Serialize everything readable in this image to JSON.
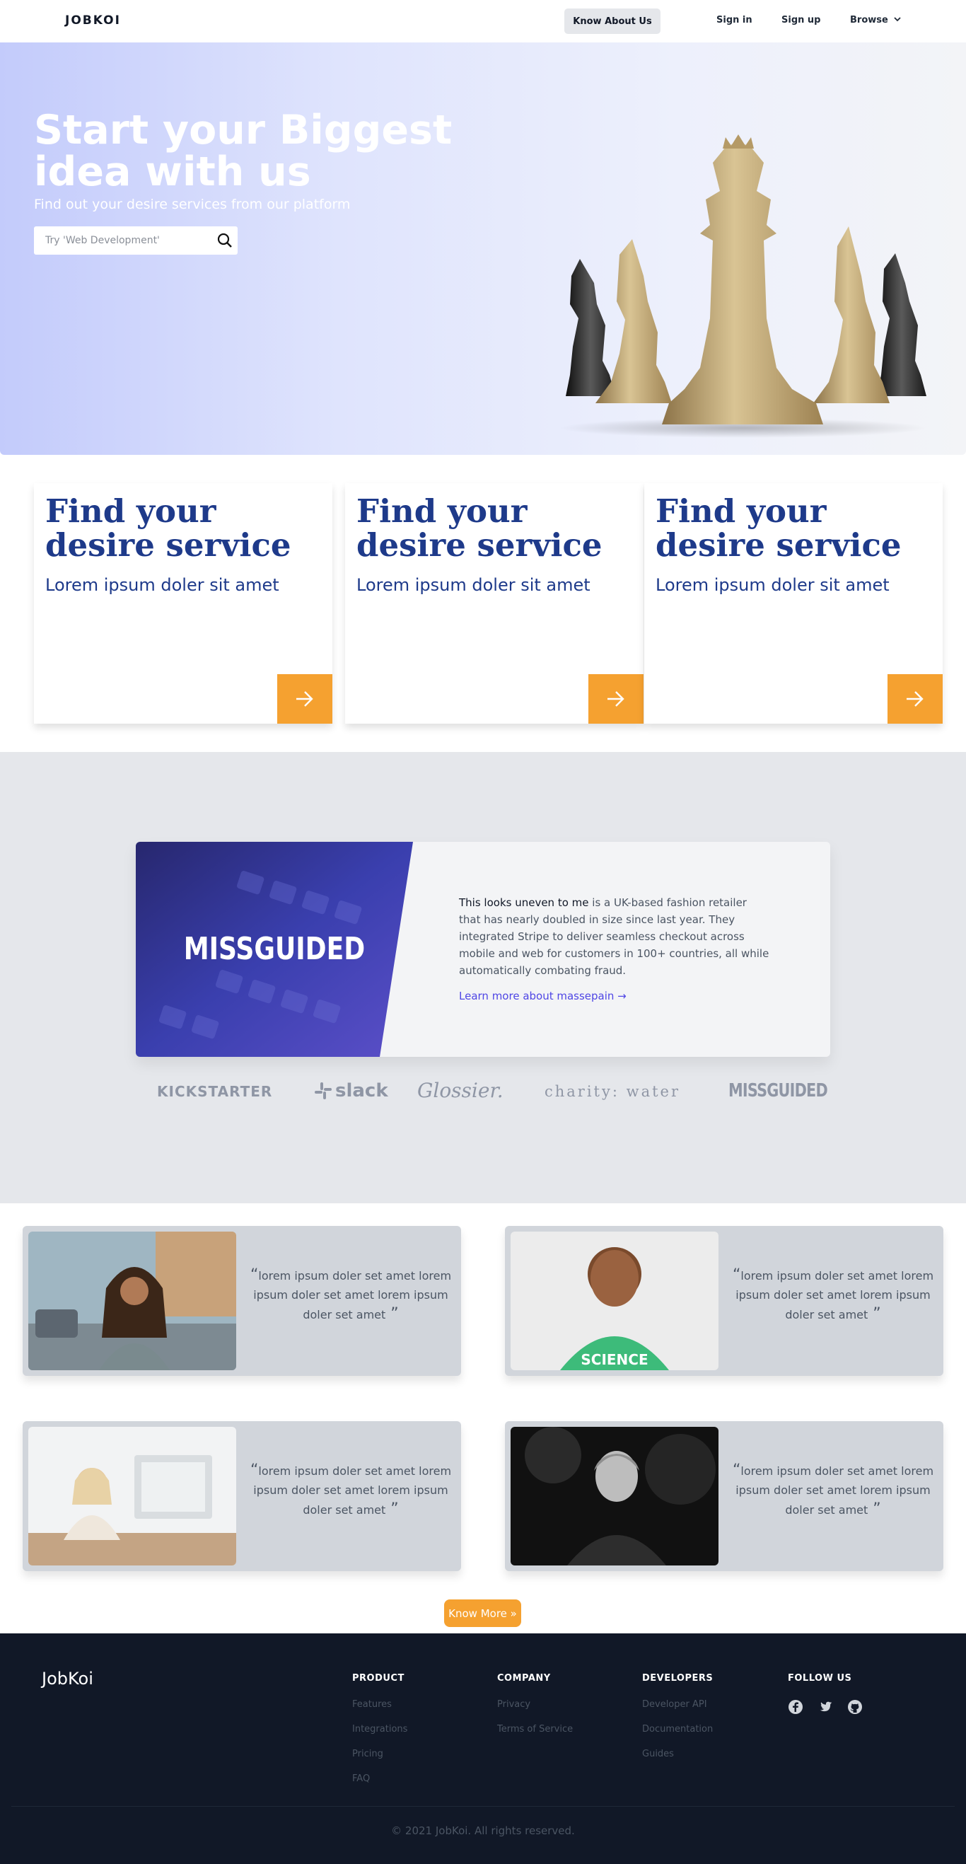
{
  "nav": {
    "logo": "JOBKOI",
    "know_about": "Know About Us",
    "sign_in": "Sign in",
    "sign_up": "Sign up",
    "browse": "Browse"
  },
  "hero": {
    "title": "Start your Biggest idea with us",
    "subtitle": "Find out your desire services from our platform",
    "search_placeholder": "Try 'Web Development'",
    "image": "chess-pieces"
  },
  "services": [
    {
      "title": "Find your desire service",
      "subtitle": "Lorem ipsum doler sit amet"
    },
    {
      "title": "Find your desire service",
      "subtitle": "Lorem ipsum doler sit amet"
    },
    {
      "title": "Find your desire service",
      "subtitle": "Lorem ipsum doler sit amet"
    }
  ],
  "customer": {
    "image_label": "MISSGUIDED",
    "lead": "This looks uneven to me",
    "body": " is a UK-based fashion retailer that has nearly doubled in size since last year. They integrated Stripe to deliver seamless checkout across mobile and web for customers in 100+ countries, all while automatically combating fraud.",
    "link": "Learn more about massepain →",
    "logos": [
      "KICKSTARTER",
      "slack",
      "Glossier.",
      "charity: water",
      "MISSGUIDED"
    ]
  },
  "testimonials": [
    {
      "quote": "lorem ipsum doler set amet lorem ipsum doler set amet lorem ipsum doler set amet"
    },
    {
      "quote": "lorem ipsum doler set amet lorem ipsum doler set amet lorem ipsum doler set amet"
    },
    {
      "quote": "lorem ipsum doler set amet lorem ipsum doler set amet lorem ipsum doler set amet"
    },
    {
      "quote": "lorem ipsum doler set amet lorem ipsum doler set amet lorem ipsum doler set amet"
    }
  ],
  "know_more": "Know More »",
  "footer": {
    "brand": "JobKoi",
    "product": {
      "heading": "PRODUCT",
      "links": [
        "Features",
        "Integrations",
        "Pricing",
        "FAQ"
      ]
    },
    "company": {
      "heading": "COMPANY",
      "links": [
        "Privacy",
        "Terms of Service"
      ]
    },
    "developers": {
      "heading": "DEVELOPERS",
      "links": [
        "Developer API",
        "Documentation",
        "Guides"
      ]
    },
    "follow": {
      "heading": "FOLLOW US",
      "icons": [
        "facebook-icon",
        "twitter-icon",
        "github-icon"
      ]
    },
    "copyright": "© 2021 JobKoi. All rights reserved."
  },
  "colors": {
    "accent": "#f5a130",
    "navy": "#1e3a8a",
    "footer_bg": "#111827",
    "link": "#4f46e5"
  }
}
